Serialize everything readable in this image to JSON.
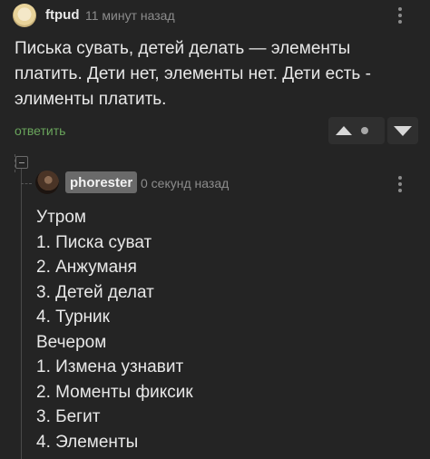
{
  "comment": {
    "username": "ftpud",
    "time": "11 минут назад",
    "text": "Писька сувать, детей делать — элементы платить. Дети нет, элементы нет. Дети есть - элименты платить.",
    "reply_label": "ответить"
  },
  "reply": {
    "username": "phorester",
    "time": "0 секунд назад",
    "lines": [
      "Утром",
      "1. Писка суват",
      "2. Анжуманя",
      "3. Детей делат",
      "4. Турник",
      "Вечером",
      "1. Измена узнавит",
      "2. Моменты фиксик",
      "3. Бегит",
      "4. Элементы"
    ]
  }
}
